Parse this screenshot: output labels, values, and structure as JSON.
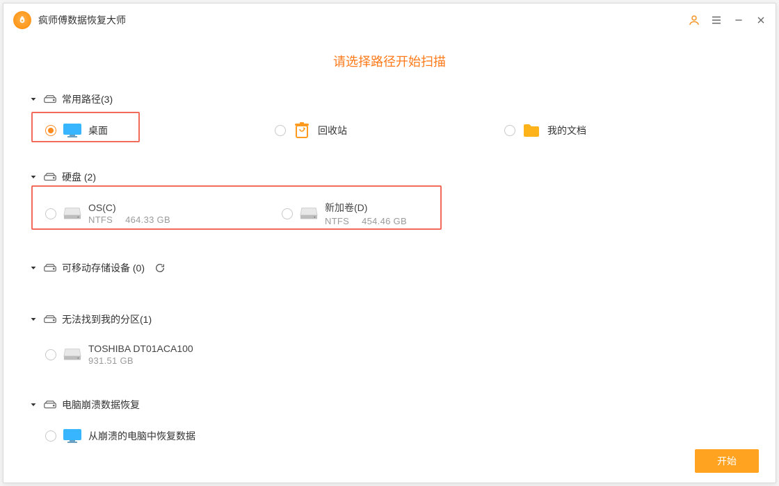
{
  "app": {
    "title": "疯师傅数据恢复大师"
  },
  "heading": "请选择路径开始扫描",
  "sections": {
    "common": {
      "label": "常用路径(3)"
    },
    "disks": {
      "label": "硬盘 (2)"
    },
    "removable": {
      "label": "可移动存储设备 (0)"
    },
    "lost": {
      "label": "无法找到我的分区(1)"
    },
    "crash": {
      "label": "电脑崩溃数据恢复"
    }
  },
  "common_items": {
    "desktop": "桌面",
    "recycle": "回收站",
    "mydocs": "我的文档"
  },
  "disks_items": {
    "c": {
      "name": "OS(C)",
      "fs": "NTFS",
      "size": "464.33 GB"
    },
    "d": {
      "name": "新加卷(D)",
      "fs": "NTFS",
      "size": "454.46 GB"
    }
  },
  "lost_items": {
    "t": {
      "name": "TOSHIBA DT01ACA100",
      "size": "931.51 GB"
    }
  },
  "crash_items": {
    "recover": "从崩溃的电脑中恢复数据"
  },
  "footer": {
    "start": "开始"
  }
}
